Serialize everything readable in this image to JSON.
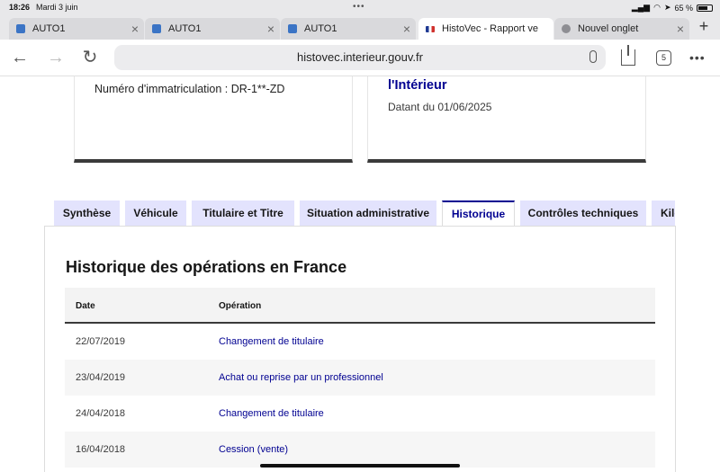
{
  "statusbar": {
    "time": "18:26",
    "date": "Mardi 3 juin",
    "dots": "•••",
    "battery": "65 %"
  },
  "browser": {
    "tabs": [
      {
        "label": "AUTO1",
        "favicon": "auto1-logo-icon"
      },
      {
        "label": "AUTO1",
        "favicon": "auto1-logo-icon"
      },
      {
        "label": "AUTO1",
        "favicon": "auto1-logo-icon"
      },
      {
        "label": "HistoVec - Rapport ve",
        "favicon": "french-flag-icon"
      },
      {
        "label": "Nouvel onglet",
        "favicon": "globe-icon"
      }
    ],
    "new_tab": "+",
    "url": "histovec.interieur.gouv.fr",
    "tab_count": "5"
  },
  "cards": {
    "registration": "Numéro d'immatriculation : DR-1**-ZD",
    "org_title": "l'Intérieur",
    "dated": "Datant du 01/06/2025"
  },
  "page_tabs": [
    "Synthèse",
    "Véhicule",
    "Titulaire et Titre",
    "Situation administrative",
    "Historique",
    "Contrôles techniques",
    "Kilo"
  ],
  "history": {
    "title": "Historique des opérations en France",
    "headers": {
      "date": "Date",
      "operation": "Opération"
    },
    "rows": [
      {
        "date": "22/07/2019",
        "operation": "Changement de titulaire"
      },
      {
        "date": "23/04/2019",
        "operation": "Achat ou reprise par un professionnel"
      },
      {
        "date": "24/04/2018",
        "operation": "Changement de titulaire"
      },
      {
        "date": "16/04/2018",
        "operation": "Cession (vente)"
      }
    ]
  },
  "colors": {
    "accent": "#000091",
    "tab_bg": "#e3e3fd"
  }
}
